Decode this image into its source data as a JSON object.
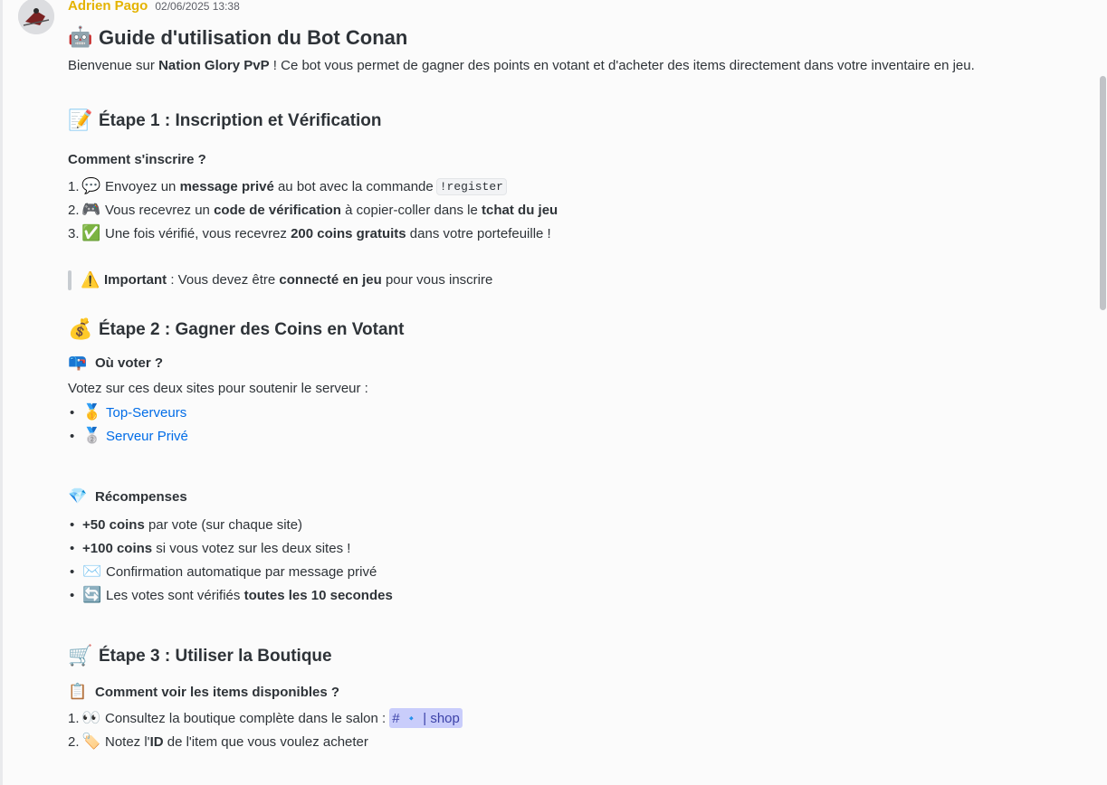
{
  "message": {
    "author": "Adrien Pago",
    "timestamp": "02/06/2025 13:38",
    "title_emoji": "🤖",
    "title": "Guide d'utilisation du Bot Conan",
    "intro": {
      "before": "Bienvenue sur ",
      "server": "Nation Glory PvP",
      "after": " ! Ce bot vous permet de gagner des points en votant et d'acheter des items directement dans votre inventaire en jeu."
    }
  },
  "step1": {
    "emoji": "📝",
    "title": "Étape 1 : Inscription et Vérification",
    "subtitle": "Comment s'inscrire ?",
    "items": [
      {
        "num": "1.",
        "emoji": "💬",
        "t1": "Envoyez un ",
        "b1": "message privé",
        "t2": " au bot avec la commande",
        "code": "!register"
      },
      {
        "num": "2.",
        "emoji": "🎮",
        "t1": "Vous recevrez un ",
        "b1": "code de vérification",
        "t2": " à copier-coller dans le ",
        "b2": "tchat du jeu"
      },
      {
        "num": "3.",
        "emoji": "✅",
        "t1": "Une fois vérifié, vous recevrez ",
        "b1": "200 coins gratuits",
        "t2": " dans votre portefeuille !"
      }
    ],
    "note": {
      "emoji": "⚠️",
      "b1": "Important",
      "t1": " : Vous devez être ",
      "b2": "connecté en jeu",
      "t2": " pour vous inscrire"
    }
  },
  "step2": {
    "emoji": "💰",
    "title": "Étape 2 : Gagner des Coins en Votant",
    "where": {
      "emoji": "📪",
      "title": "Où voter ?"
    },
    "where_text": "Votez sur ces deux sites pour soutenir le serveur :",
    "links": [
      {
        "emoji": "🥇",
        "label": "Top-Serveurs"
      },
      {
        "emoji": "🥈",
        "label": "Serveur Privé"
      }
    ],
    "rewards": {
      "emoji": "💎",
      "title": "Récompenses"
    },
    "reward_items": [
      {
        "b1": "+50 coins",
        "t1": " par vote (sur chaque site)"
      },
      {
        "b1": "+100 coins",
        "t1": " si vous votez sur les deux sites !"
      },
      {
        "emoji": "✉️",
        "t1": "Confirmation automatique par message privé"
      },
      {
        "emoji": "🔄",
        "t1": "Les votes sont vérifiés ",
        "b1": "toutes les 10 secondes"
      }
    ]
  },
  "step3": {
    "emoji": "🛒",
    "title": "Étape 3 : Utiliser la Boutique",
    "sub": {
      "emoji": "📋",
      "title": "Comment voir les items disponibles ?"
    },
    "items": [
      {
        "num": "1.",
        "emoji": "👀",
        "t1": "Consultez la boutique complète dans le salon :",
        "channel_hash": "#",
        "channel_icon": "🔹",
        "channel_name": "| shop"
      },
      {
        "num": "2.",
        "emoji": "🏷️",
        "t1": "Notez l'",
        "b1": "ID",
        "t2": " de l'item que vous voulez acheter"
      }
    ]
  }
}
